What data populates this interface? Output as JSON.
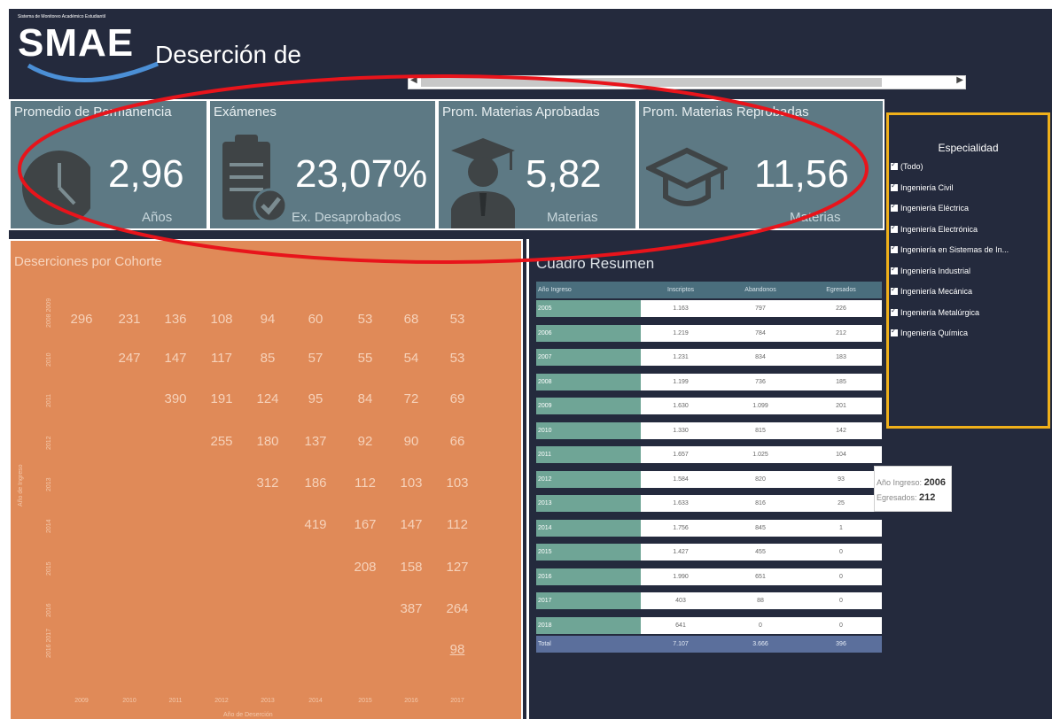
{
  "header": {
    "logo_tagline": "Sistema de Monitoreo Académico Estudiantil",
    "logo_text": "SMAE",
    "title": "Deserción de"
  },
  "kpis": [
    {
      "title": "Promedio de Permanencia",
      "value": "2,96",
      "unit": "Años",
      "icon": "clock-icon"
    },
    {
      "title": "Exámenes",
      "value": "23,07%",
      "unit": "Ex. Desaprobados",
      "icon": "clipboard-check-icon"
    },
    {
      "title": "Prom. Materias Aprobadas",
      "value": "5,82",
      "unit": "Materias",
      "icon": "graduate-icon"
    },
    {
      "title": "Prom. Materias Reprobadas",
      "value": "11,56",
      "unit": "Materias",
      "icon": "graduation-cap-icon"
    }
  ],
  "cohort": {
    "title": "Deserciones por Cohorte",
    "y_axis_label": "Año de Ingreso",
    "x_axis_label": "Año de Deserción",
    "row_labels": [
      "2008 2009",
      "2010",
      "2011",
      "2012",
      "2013",
      "2014",
      "2015",
      "2016",
      "2016 2017"
    ],
    "col_labels": [
      "2009",
      "2010",
      "2011",
      "2012",
      "2013",
      "2014",
      "2015",
      "2016",
      "2017"
    ],
    "rows": [
      [
        "296",
        "231",
        "136",
        "108",
        "94",
        "60",
        "53",
        "68",
        "53"
      ],
      [
        "",
        "247",
        "147",
        "117",
        "85",
        "57",
        "55",
        "54",
        "53"
      ],
      [
        "",
        "",
        "390",
        "191",
        "124",
        "95",
        "84",
        "72",
        "69"
      ],
      [
        "",
        "",
        "",
        "255",
        "180",
        "137",
        "92",
        "90",
        "66"
      ],
      [
        "",
        "",
        "",
        "",
        "312",
        "186",
        "112",
        "103",
        "103"
      ],
      [
        "",
        "",
        "",
        "",
        "",
        "419",
        "167",
        "147",
        "112"
      ],
      [
        "",
        "",
        "",
        "",
        "",
        "",
        "208",
        "158",
        "127"
      ],
      [
        "",
        "",
        "",
        "",
        "",
        "",
        "",
        "387",
        "264"
      ],
      [
        "",
        "",
        "",
        "",
        "",
        "",
        "",
        "",
        "98"
      ]
    ]
  },
  "summary": {
    "title": "Cuadro Resumen",
    "headers": [
      "Año Ingreso",
      "Inscriptos",
      "Abandonos",
      "Egresados"
    ],
    "rows": [
      [
        "2005",
        "1.163",
        "797",
        "226"
      ],
      [
        "2006",
        "1.219",
        "784",
        "212"
      ],
      [
        "2007",
        "1.231",
        "834",
        "183"
      ],
      [
        "2008",
        "1.199",
        "736",
        "185"
      ],
      [
        "2009",
        "1.630",
        "1.099",
        "201"
      ],
      [
        "2010",
        "1.330",
        "815",
        "142"
      ],
      [
        "2011",
        "1.657",
        "1.025",
        "104"
      ],
      [
        "2012",
        "1.584",
        "820",
        "93"
      ],
      [
        "2013",
        "1.633",
        "816",
        "25"
      ],
      [
        "2014",
        "1.756",
        "845",
        "1"
      ],
      [
        "2015",
        "1.427",
        "455",
        "0"
      ],
      [
        "2016",
        "1.990",
        "651",
        "0"
      ],
      [
        "2017",
        "403",
        "88",
        "0"
      ],
      [
        "2018",
        "641",
        "0",
        "0"
      ]
    ],
    "total": [
      "Total",
      "7.107",
      "3.666",
      "396"
    ]
  },
  "filter": {
    "title": "Especialidad",
    "items": [
      "(Todo)",
      "Ingeniería Civil",
      "Ingeniería Eléctrica",
      "Ingeniería Electrónica",
      "Ingeniería en Sistemas de In...",
      "Ingeniería Industrial",
      "Ingeniería Mecánica",
      "Ingeniería Metalúrgica",
      "Ingeniería Química"
    ]
  },
  "tooltip": {
    "line1_label": "Año Ingreso:",
    "line1_value": "2006",
    "line2_label": "Egresados:",
    "line2_value": "212"
  },
  "colors": {
    "background": "#242a3d",
    "kpi": "#5d7984",
    "cohort": "#e08a58",
    "table_first_col": "#6fa596",
    "filter_border": "#f0b01a",
    "annotation": "#e8141b"
  }
}
